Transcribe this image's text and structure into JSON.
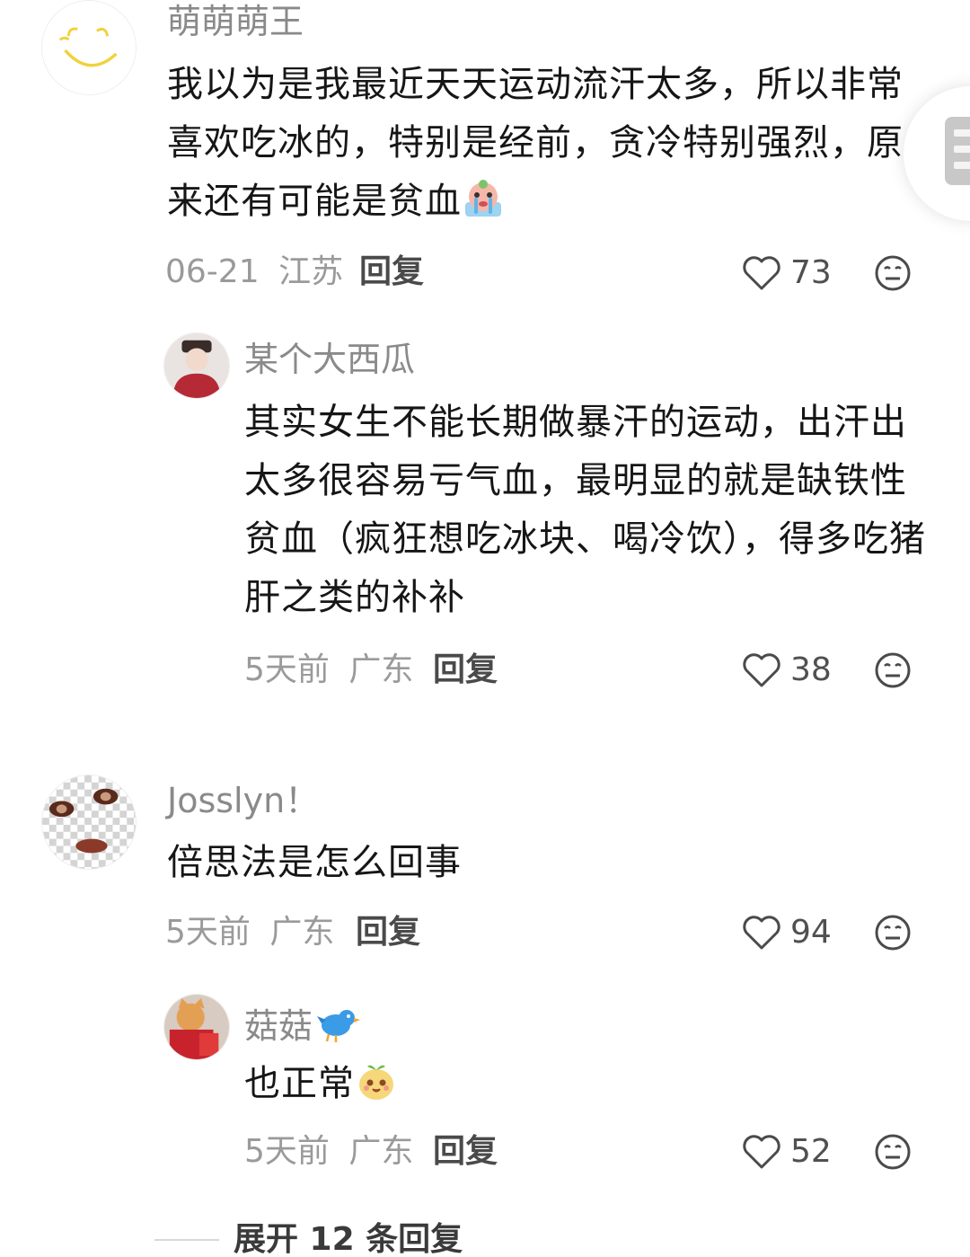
{
  "comments": [
    {
      "username": "萌萌萌王",
      "text": "我以为是我最近天天运动流汗太多，所以非常喜欢吃冰的，特别是经前，贪冷特别强烈，原来还有可能是贫血",
      "date": "06-21",
      "location": "江苏",
      "reply_label": "回复",
      "likes": "73",
      "emoji": "crying-face-emoji",
      "replies": [
        {
          "username": "某个大西瓜",
          "text": "其实女生不能长期做暴汗的运动，出汗出太多很容易亏气血，最明显的就是缺铁性贫血（疯狂想吃冰块、喝冷饮），得多吃猪肝之类的补补",
          "date": "5天前",
          "location": "广东",
          "reply_label": "回复",
          "likes": "38"
        }
      ]
    },
    {
      "username": "Josslyn！",
      "text": "倍思法是怎么回事",
      "date": "5天前",
      "location": "广东",
      "reply_label": "回复",
      "likes": "94",
      "replies": [
        {
          "username": "菇菇",
          "username_emoji": "bird-emoji",
          "text": "也正常",
          "emoji": "smiling-potato-emoji",
          "date": "5天前",
          "location": "广东",
          "reply_label": "回复",
          "likes": "52"
        }
      ]
    }
  ],
  "expand_replies_label": "展开 12 条回复",
  "icons": {
    "like": "heart-outline-icon",
    "dislike": "neutral-face-icon",
    "side": "list-panel-icon"
  },
  "colors": {
    "username": "#8a8a8a",
    "text": "#161616",
    "meta": "#9a9a9a",
    "icon": "#4a4a4a"
  }
}
